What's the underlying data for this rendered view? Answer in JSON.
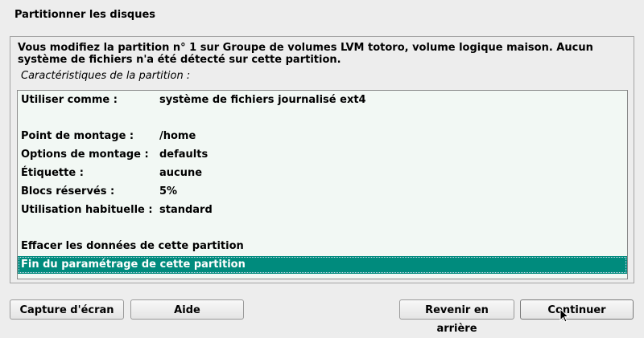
{
  "window": {
    "title": "Partitionner les disques"
  },
  "description": "Vous modifiez la partition n° 1 sur Groupe de volumes LVM totoro, volume logique maison. Aucun système de fichiers n'a été détecté sur cette partition.",
  "subtitle": "Caractéristiques de la partition :",
  "settings": [
    {
      "key": "Utiliser comme :",
      "value": "système de fichiers journalisé ext4"
    },
    {
      "key": "Point de montage :",
      "value": "/home"
    },
    {
      "key": "Options de montage :",
      "value": "defaults"
    },
    {
      "key": "Étiquette :",
      "value": "aucune"
    },
    {
      "key": "Blocs réservés :",
      "value": "5%"
    },
    {
      "key": "Utilisation habituelle :",
      "value": "standard"
    }
  ],
  "actions": [
    {
      "label": "Effacer les données de cette partition",
      "selected": false
    },
    {
      "label": "Fin du paramétrage de cette partition",
      "selected": true
    }
  ],
  "buttons": {
    "screenshot": "Capture d'écran",
    "help": "Aide",
    "back": "Revenir en arrière",
    "continue": "Continuer"
  },
  "colors": {
    "selection": "#008b7d",
    "list_background": "#f2f8f4",
    "window_background": "#ededed"
  }
}
